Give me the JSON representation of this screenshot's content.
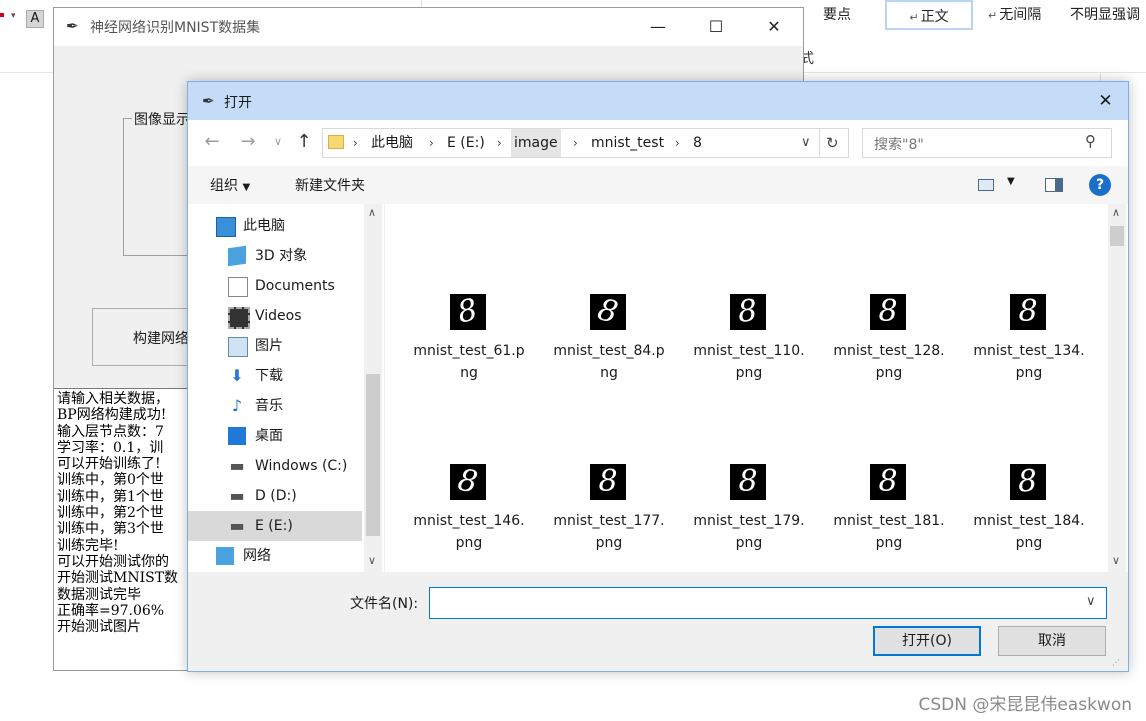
{
  "background": {
    "ribbon_letter": "A",
    "style_yaodian": "要点",
    "style_zhengwen": "正文",
    "style_wujiange": "无间隔",
    "style_bumingxian": "不明显强调",
    "fragment_char": "式"
  },
  "main_window": {
    "title": "神经网络识别MNIST数据集",
    "group_label": "图像显示",
    "build_button": "构建网络",
    "log_lines": [
      "请输入相关数据，",
      "BP网络构建成功!",
      "输入层节点数：7",
      "学习率：0.1，训",
      "可以开始训练了!",
      "训练中，第0个世",
      "训练中，第1个世",
      "训练中，第2个世",
      "训练中，第3个世",
      "训练完毕!",
      "可以开始测试你的",
      "开始测试MNIST数",
      "数据测试完毕",
      "正确率=97.06%",
      "开始测试图片"
    ]
  },
  "dialog": {
    "title": "打开",
    "breadcrumbs": [
      "此电脑",
      "E (E:)",
      "image",
      "mnist_test",
      "8"
    ],
    "search_placeholder": "搜索\"8\"",
    "toolbar": {
      "organize": "组织",
      "new_folder": "新建文件夹"
    },
    "nav_items": [
      {
        "label": "此电脑",
        "icon": "computer-icon"
      },
      {
        "label": "3D 对象",
        "icon": "cube-icon"
      },
      {
        "label": "Documents",
        "icon": "document-icon"
      },
      {
        "label": "Videos",
        "icon": "film-icon"
      },
      {
        "label": "图片",
        "icon": "picture-icon"
      },
      {
        "label": "下载",
        "icon": "download-icon"
      },
      {
        "label": "音乐",
        "icon": "music-icon"
      },
      {
        "label": "桌面",
        "icon": "desktop-icon"
      },
      {
        "label": "Windows (C:)",
        "icon": "drive-icon"
      },
      {
        "label": "D (D:)",
        "icon": "drive-icon"
      },
      {
        "label": "E (E:)",
        "icon": "drive-icon",
        "selected": true
      },
      {
        "label": "网络",
        "icon": "network-icon"
      }
    ],
    "files": [
      {
        "name": "mnist_test_61.png",
        "glyph": "8"
      },
      {
        "name": "mnist_test_84.png",
        "glyph": "8"
      },
      {
        "name": "mnist_test_110.png",
        "glyph": "8"
      },
      {
        "name": "mnist_test_128.png",
        "glyph": "8"
      },
      {
        "name": "mnist_test_134.png",
        "glyph": "8"
      },
      {
        "name": "mnist_test_146.png",
        "glyph": "8"
      },
      {
        "name": "mnist_test_177.png",
        "glyph": "8"
      },
      {
        "name": "mnist_test_179.png",
        "glyph": "8"
      },
      {
        "name": "mnist_test_181.png",
        "glyph": "8"
      },
      {
        "name": "mnist_test_184.png",
        "glyph": "8"
      }
    ],
    "filename_label": "文件名(N):",
    "filename_value": "",
    "open_button": "打开(O)",
    "cancel_button": "取消"
  },
  "watermark": "CSDN @宋昆昆伟easkwon",
  "colors": {
    "dialog_titlebar": "#c4dcf7",
    "accent": "#0078d7",
    "selected_nav": "#d9d9d9"
  }
}
